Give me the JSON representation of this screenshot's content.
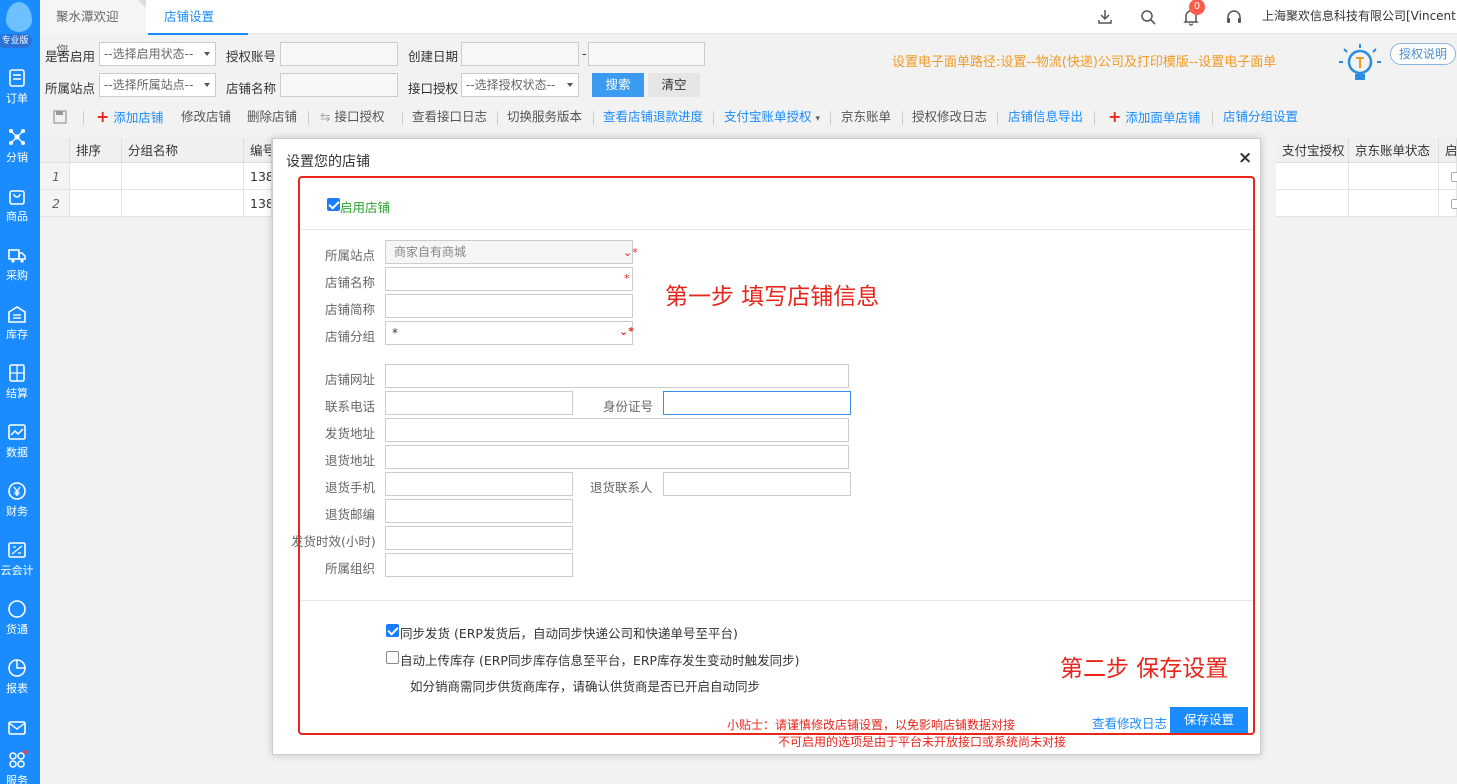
{
  "sidebar": {
    "edition": "专业版",
    "items": [
      "订单",
      "分销",
      "商品",
      "采购",
      "库存",
      "结算",
      "数据",
      "财务",
      "云会计",
      "货通",
      "报表",
      "消息",
      "服务"
    ]
  },
  "tabs": {
    "welcome": "聚水潭欢迎您",
    "active": "店铺设置"
  },
  "header": {
    "notification_count": "0",
    "company": "上海聚欢信息科技有限公司[Vincent"
  },
  "filters": {
    "enabled_label": "是否启用",
    "enabled_value": "--选择启用状态--",
    "auth_account_label": "授权账号",
    "created_label": "创建日期",
    "date_sep": "-",
    "site_label": "所属站点",
    "site_value": "--选择所属站点--",
    "shop_name_label": "店铺名称",
    "api_auth_label": "接口授权",
    "api_auth_value": "--选择授权状态--",
    "search": "搜索",
    "clear": "清空"
  },
  "hint": "设置电子面单路径:设置--物流(快递)公司及打印模版--设置电子面单",
  "auth_help": "授权说明",
  "toolbar": {
    "add_shop": "添加店铺",
    "edit_shop": "修改店铺",
    "delete_shop": "删除店铺",
    "api_auth": "接口授权",
    "api_log": "查看接口日志",
    "switch_version": "切换服务版本",
    "refund_progress": "查看店铺退款进度",
    "alipay_auth": "支付宝账单授权",
    "jd_bill": "京东账单",
    "auth_log": "授权修改日志",
    "export": "店铺信息导出",
    "add_waybill_shop": "添加面单店铺",
    "group_settings": "店铺分组设置"
  },
  "grid": {
    "headers": {
      "sort": "排序",
      "group": "分组名称",
      "code": "编号",
      "alipay": "支付宝授权",
      "jd_status": "京东账单状态",
      "enabled": "启"
    },
    "rows": [
      {
        "n": "1",
        "code": "138"
      },
      {
        "n": "2",
        "code": "138"
      }
    ]
  },
  "dialog": {
    "title": "设置您的店铺",
    "close": "×",
    "enable_shop": "启用店铺",
    "site_label": "所属站点",
    "site_value": "商家自有商城",
    "name_label": "店铺名称",
    "short_label": "店铺简称",
    "group_label": "店铺分组",
    "group_value": "*",
    "url_label": "店铺网址",
    "phone_label": "联系电话",
    "id_label": "身份证号",
    "ship_addr_label": "发货地址",
    "return_addr_label": "退货地址",
    "return_phone_label": "退货手机",
    "return_contact_label": "退货联系人",
    "return_zip_label": "退货邮编",
    "ship_time_label": "发货时效(小时)",
    "org_label": "所属组织",
    "step1": "第一步 填写店铺信息",
    "step2": "第二步 保存设置",
    "sync_ship": "同步发货 (ERP发货后，自动同步快递公司和快递单号至平台)",
    "auto_stock": "自动上传库存 (ERP同步库存信息至平台，ERP库存发生变动时触发同步)",
    "stock_note": "如分销商需同步供货商库存，请确认供货商是否已开启自动同步",
    "tip1": "小贴士：请谨慎修改店铺设置，以免影响店铺数据对接",
    "tip2": "不可启用的选项是由于平台未开放接口或系统尚未对接",
    "view_log": "查看修改日志",
    "save": "保存设置"
  },
  "colors": {
    "brand": "#1a8cff",
    "warning": "#f29b22",
    "annotation": "#e8261c"
  }
}
